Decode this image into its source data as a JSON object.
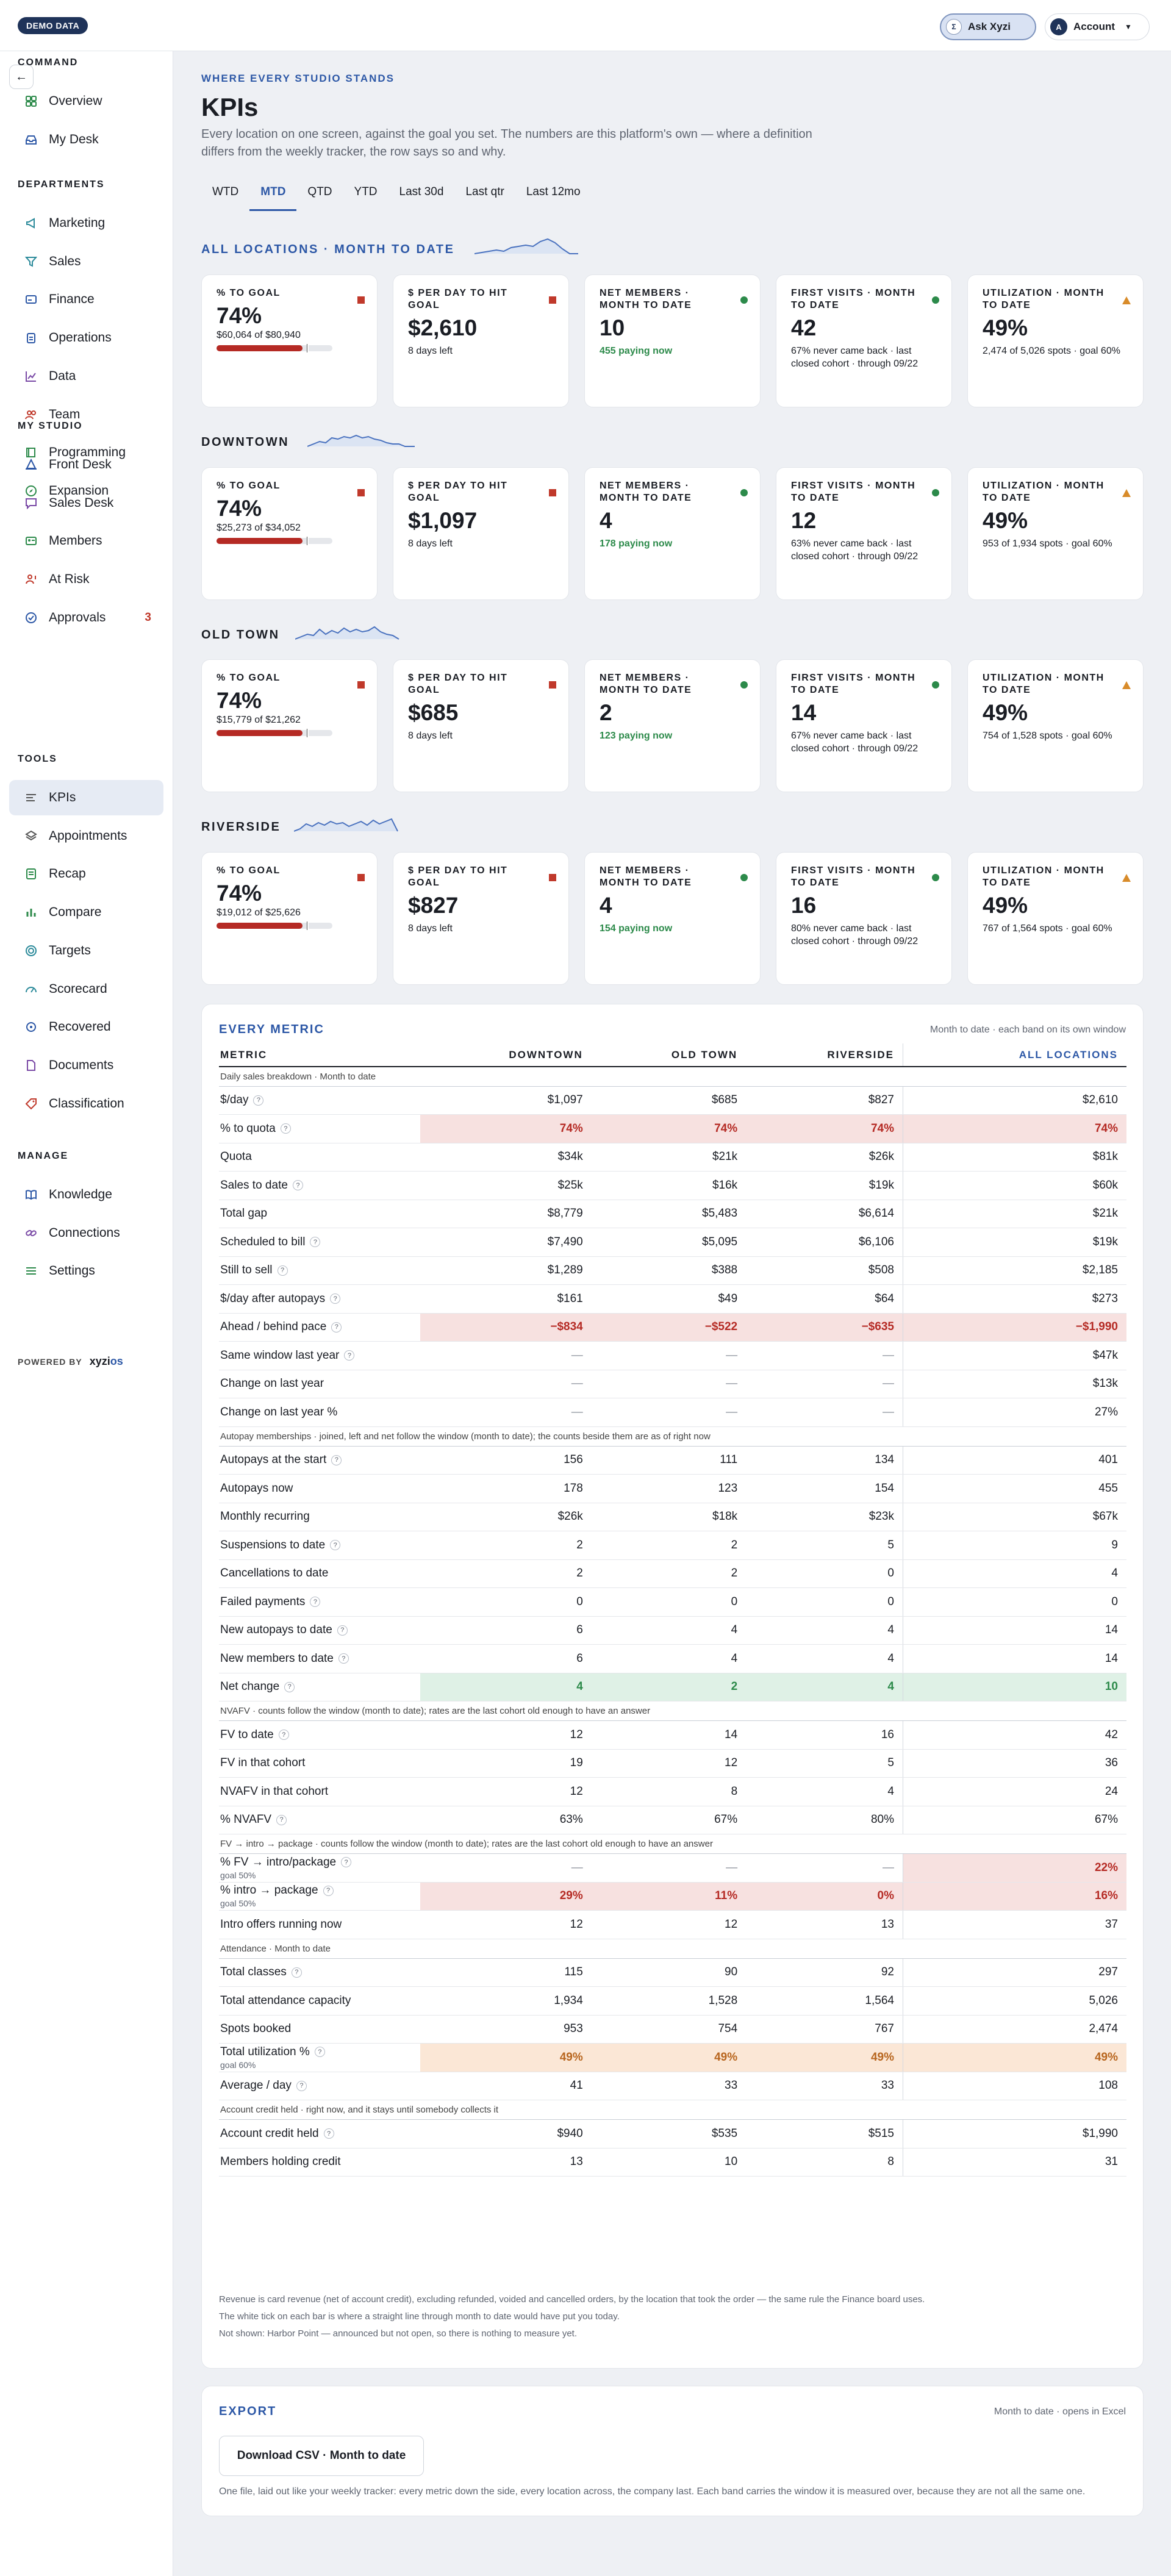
{
  "topbar": {
    "demo_badge": "DEMO DATA",
    "ask_label": "Ask Xyzi",
    "ask_icon": "Σ",
    "account_label": "Account",
    "account_initial": "A"
  },
  "sidebar": {
    "sections": [
      {
        "title": "COMMAND",
        "items": [
          {
            "label": "Overview",
            "icon": "grid-icon"
          },
          {
            "label": "My Desk",
            "icon": "inbox-icon"
          }
        ]
      },
      {
        "title": "DEPARTMENTS",
        "items": [
          {
            "label": "Marketing",
            "icon": "megaphone-icon"
          },
          {
            "label": "Sales",
            "icon": "funnel-icon"
          },
          {
            "label": "Finance",
            "icon": "card-icon"
          },
          {
            "label": "Operations",
            "icon": "clipboard-icon"
          },
          {
            "label": "Data",
            "icon": "chart-icon"
          },
          {
            "label": "Team",
            "icon": "people-icon"
          },
          {
            "label": "Programming",
            "icon": "book-icon"
          },
          {
            "label": "Expansion",
            "icon": "compass-icon"
          }
        ]
      },
      {
        "title": "MY STUDIO",
        "items": [
          {
            "label": "Front Desk",
            "icon": "bell-icon"
          },
          {
            "label": "Sales Desk",
            "icon": "chat-icon"
          },
          {
            "label": "Members",
            "icon": "id-card-icon"
          },
          {
            "label": "At Risk",
            "icon": "person-alert-icon"
          },
          {
            "label": "Approvals",
            "icon": "check-circle-icon",
            "badge": "3"
          }
        ]
      },
      {
        "title": "TOOLS",
        "items": [
          {
            "label": "KPIs",
            "icon": "gauge-icon",
            "active": true
          },
          {
            "label": "Appointments",
            "icon": "layers-icon"
          },
          {
            "label": "Recap",
            "icon": "document-icon"
          },
          {
            "label": "Compare",
            "icon": "bar-chart-icon"
          },
          {
            "label": "Targets",
            "icon": "target-icon"
          },
          {
            "label": "Scorecard",
            "icon": "meter-icon"
          },
          {
            "label": "Recovered",
            "icon": "refresh-icon"
          },
          {
            "label": "Documents",
            "icon": "file-icon"
          },
          {
            "label": "Classification",
            "icon": "tag-icon"
          }
        ]
      },
      {
        "title": "MANAGE",
        "items": [
          {
            "label": "Knowledge",
            "icon": "open-book-icon"
          },
          {
            "label": "Connections",
            "icon": "link-icon"
          },
          {
            "label": "Settings",
            "icon": "sliders-icon"
          }
        ]
      }
    ],
    "powered_by": "POWERED BY",
    "brand": "xyzi",
    "brand_suffix": "os"
  },
  "header": {
    "eyebrow": "WHERE EVERY STUDIO STANDS",
    "title": "KPIs",
    "description": "Every location on one screen, against the goal you set. The numbers are this platform's own — where a definition differs from the weekly tracker, the row says so and why."
  },
  "tabs": [
    "WTD",
    "MTD",
    "QTD",
    "YTD",
    "Last 30d",
    "Last qtr",
    "Last 12mo"
  ],
  "active_tab": "MTD",
  "locations": [
    {
      "label": "ALL LOCATIONS · MONTH TO DATE",
      "cards": {
        "goal": {
          "label": "% TO GOAL",
          "value": "74%",
          "sub": "$60,064 of $80,940",
          "progress": 0.74
        },
        "perday": {
          "label": "$ PER DAY TO HIT GOAL",
          "value": "$2,610",
          "sub": "8 days left"
        },
        "net": {
          "label": "NET MEMBERS · MONTH TO DATE",
          "value": "10",
          "sub": "455 paying now"
        },
        "fv": {
          "label": "FIRST VISITS · MONTH TO DATE",
          "value": "42",
          "sub": "67% never came back · last closed cohort · through 09/22"
        },
        "util": {
          "label": "UTILIZATION · MONTH TO DATE",
          "value": "49%",
          "sub": "2,474 of 5,026 spots · goal 60%"
        }
      }
    },
    {
      "label": "DOWNTOWN",
      "cards": {
        "goal": {
          "label": "% TO GOAL",
          "value": "74%",
          "sub": "$25,273 of $34,052",
          "progress": 0.74
        },
        "perday": {
          "label": "$ PER DAY TO HIT GOAL",
          "value": "$1,097",
          "sub": "8 days left"
        },
        "net": {
          "label": "NET MEMBERS · MONTH TO DATE",
          "value": "4",
          "sub": "178 paying now"
        },
        "fv": {
          "label": "FIRST VISITS · MONTH TO DATE",
          "value": "12",
          "sub": "63% never came back · last closed cohort · through 09/22"
        },
        "util": {
          "label": "UTILIZATION · MONTH TO DATE",
          "value": "49%",
          "sub": "953 of 1,934 spots · goal 60%"
        }
      }
    },
    {
      "label": "OLD TOWN",
      "cards": {
        "goal": {
          "label": "% TO GOAL",
          "value": "74%",
          "sub": "$15,779 of $21,262",
          "progress": 0.74
        },
        "perday": {
          "label": "$ PER DAY TO HIT GOAL",
          "value": "$685",
          "sub": "8 days left"
        },
        "net": {
          "label": "NET MEMBERS · MONTH TO DATE",
          "value": "2",
          "sub": "123 paying now"
        },
        "fv": {
          "label": "FIRST VISITS · MONTH TO DATE",
          "value": "14",
          "sub": "67% never came back · last closed cohort · through 09/22"
        },
        "util": {
          "label": "UTILIZATION · MONTH TO DATE",
          "value": "49%",
          "sub": "754 of 1,528 spots · goal 60%"
        }
      }
    },
    {
      "label": "RIVERSIDE",
      "cards": {
        "goal": {
          "label": "% TO GOAL",
          "value": "74%",
          "sub": "$19,012 of $25,626",
          "progress": 0.74
        },
        "perday": {
          "label": "$ PER DAY TO HIT GOAL",
          "value": "$827",
          "sub": "8 days left"
        },
        "net": {
          "label": "NET MEMBERS · MONTH TO DATE",
          "value": "4",
          "sub": "154 paying now"
        },
        "fv": {
          "label": "FIRST VISITS · MONTH TO DATE",
          "value": "16",
          "sub": "80% never came back · last closed cohort · through 09/22"
        },
        "util": {
          "label": "UTILIZATION · MONTH TO DATE",
          "value": "49%",
          "sub": "767 of 1,564 spots · goal 60%"
        }
      }
    }
  ],
  "metrics": {
    "title": "EVERY METRIC",
    "note": "Month to date · each band on its own window",
    "columns": [
      "METRIC",
      "DOWNTOWN",
      "OLD TOWN",
      "RIVERSIDE",
      "ALL LOCATIONS"
    ],
    "sections": [
      {
        "title": "Daily sales breakdown · Month to date",
        "rows": [
          {
            "label": "$/day",
            "help": true,
            "values": [
              "$1,097",
              "$685",
              "$827",
              "$2,610"
            ]
          },
          {
            "label": "% to quota",
            "help": true,
            "tone": "red",
            "values": [
              "74%",
              "74%",
              "74%",
              "74%"
            ]
          },
          {
            "label": "Quota",
            "values": [
              "$34k",
              "$21k",
              "$26k",
              "$81k"
            ]
          },
          {
            "label": "Sales to date",
            "help": true,
            "values": [
              "$25k",
              "$16k",
              "$19k",
              "$60k"
            ]
          },
          {
            "label": "Total gap",
            "values": [
              "$8,779",
              "$5,483",
              "$6,614",
              "$21k"
            ]
          },
          {
            "label": "Scheduled to bill",
            "help": true,
            "values": [
              "$7,490",
              "$5,095",
              "$6,106",
              "$19k"
            ]
          },
          {
            "label": "Still to sell",
            "help": true,
            "values": [
              "$1,289",
              "$388",
              "$508",
              "$2,185"
            ]
          },
          {
            "label": "$/day after autopays",
            "help": true,
            "values": [
              "$161",
              "$49",
              "$64",
              "$273"
            ]
          },
          {
            "label": "Ahead / behind pace",
            "help": true,
            "tone": "red",
            "values": [
              "−$834",
              "−$522",
              "−$635",
              "−$1,990"
            ]
          },
          {
            "label": "Same window last year",
            "help": true,
            "values": [
              "—",
              "—",
              "—",
              "$47k"
            ]
          },
          {
            "label": "Change on last year",
            "values": [
              "—",
              "—",
              "—",
              "$13k"
            ]
          },
          {
            "label": "Change on last year %",
            "values": [
              "—",
              "—",
              "—",
              "27%"
            ]
          }
        ]
      },
      {
        "title": "Autopay memberships · joined, left and net follow the window (month to date); the counts beside them are as of right now",
        "rows": [
          {
            "label": "Autopays at the start",
            "help": true,
            "values": [
              "156",
              "111",
              "134",
              "401"
            ]
          },
          {
            "label": "Autopays now",
            "values": [
              "178",
              "123",
              "154",
              "455"
            ]
          },
          {
            "label": "Monthly recurring",
            "values": [
              "$26k",
              "$18k",
              "$23k",
              "$67k"
            ]
          },
          {
            "label": "Suspensions to date",
            "help": true,
            "values": [
              "2",
              "2",
              "5",
              "9"
            ]
          },
          {
            "label": "Cancellations to date",
            "values": [
              "2",
              "2",
              "0",
              "4"
            ]
          },
          {
            "label": "Failed payments",
            "help": true,
            "values": [
              "0",
              "0",
              "0",
              "0"
            ]
          },
          {
            "label": "New autopays to date",
            "help": true,
            "values": [
              "6",
              "4",
              "4",
              "14"
            ]
          },
          {
            "label": "New members to date",
            "help": true,
            "values": [
              "6",
              "4",
              "4",
              "14"
            ]
          },
          {
            "label": "Net change",
            "help": true,
            "tone": "green",
            "values": [
              "4",
              "2",
              "4",
              "10"
            ]
          }
        ]
      },
      {
        "title": "NVAFV · counts follow the window (month to date); rates are the last cohort old enough to have an answer",
        "rows": [
          {
            "label": "FV to date",
            "help": true,
            "values": [
              "12",
              "14",
              "16",
              "42"
            ]
          },
          {
            "label": "FV in that cohort",
            "values": [
              "19",
              "12",
              "5",
              "36"
            ]
          },
          {
            "label": "NVAFV in that cohort",
            "values": [
              "12",
              "8",
              "4",
              "24"
            ]
          },
          {
            "label": "% NVAFV",
            "help": true,
            "values": [
              "63%",
              "67%",
              "80%",
              "67%"
            ]
          }
        ]
      },
      {
        "title": "FV → intro → package · counts follow the window (month to date); rates are the last cohort old enough to have an answer",
        "rows": [
          {
            "label": "% FV → intro/package",
            "help": true,
            "goal": "goal 50%",
            "tone": "red-last",
            "values": [
              "—",
              "—",
              "—",
              "22%"
            ]
          },
          {
            "label": "% intro → package",
            "help": true,
            "goal": "goal 50%",
            "tone": "red",
            "values": [
              "29%",
              "11%",
              "0%",
              "16%"
            ]
          },
          {
            "label": "Intro offers running now",
            "values": [
              "12",
              "12",
              "13",
              "37"
            ]
          }
        ]
      },
      {
        "title": "Attendance · Month to date",
        "rows": [
          {
            "label": "Total classes",
            "help": true,
            "values": [
              "115",
              "90",
              "92",
              "297"
            ]
          },
          {
            "label": "Total attendance capacity",
            "values": [
              "1,934",
              "1,528",
              "1,564",
              "5,026"
            ]
          },
          {
            "label": "Spots booked",
            "values": [
              "953",
              "754",
              "767",
              "2,474"
            ]
          },
          {
            "label": "Total utilization %",
            "help": true,
            "goal": "goal 60%",
            "tone": "amber",
            "values": [
              "49%",
              "49%",
              "49%",
              "49%"
            ]
          },
          {
            "label": "Average / day",
            "help": true,
            "values": [
              "41",
              "33",
              "33",
              "108"
            ]
          }
        ]
      },
      {
        "title": "Account credit held · right now, and it stays until somebody collects it",
        "rows": [
          {
            "label": "Account credit held",
            "help": true,
            "values": [
              "$940",
              "$535",
              "$515",
              "$1,990"
            ]
          },
          {
            "label": "Members holding credit",
            "values": [
              "13",
              "10",
              "8",
              "31"
            ]
          }
        ]
      }
    ],
    "footnotes": [
      "Revenue is card revenue (net of account credit), excluding refunded, voided and cancelled orders, by the location that took the order — the same rule the Finance board uses.",
      "The white tick on each bar is where a straight line through month to date would have put you today.",
      "Not shown: Harbor Point — announced but not open, so there is nothing to measure yet."
    ]
  },
  "export": {
    "title": "EXPORT",
    "note": "Month to date · opens in Excel",
    "button": "Download CSV · Month to date",
    "description": "One file, laid out like your weekly tracker: every metric down the side, every location across, the company last. Each band carries the window it is measured over, because they are not all the same one."
  },
  "colors": {
    "accent": "#2c57a6",
    "danger": "#b52a24",
    "success": "#2c8a4a",
    "warning": "#d88b2a",
    "navy": "#1f3359"
  }
}
